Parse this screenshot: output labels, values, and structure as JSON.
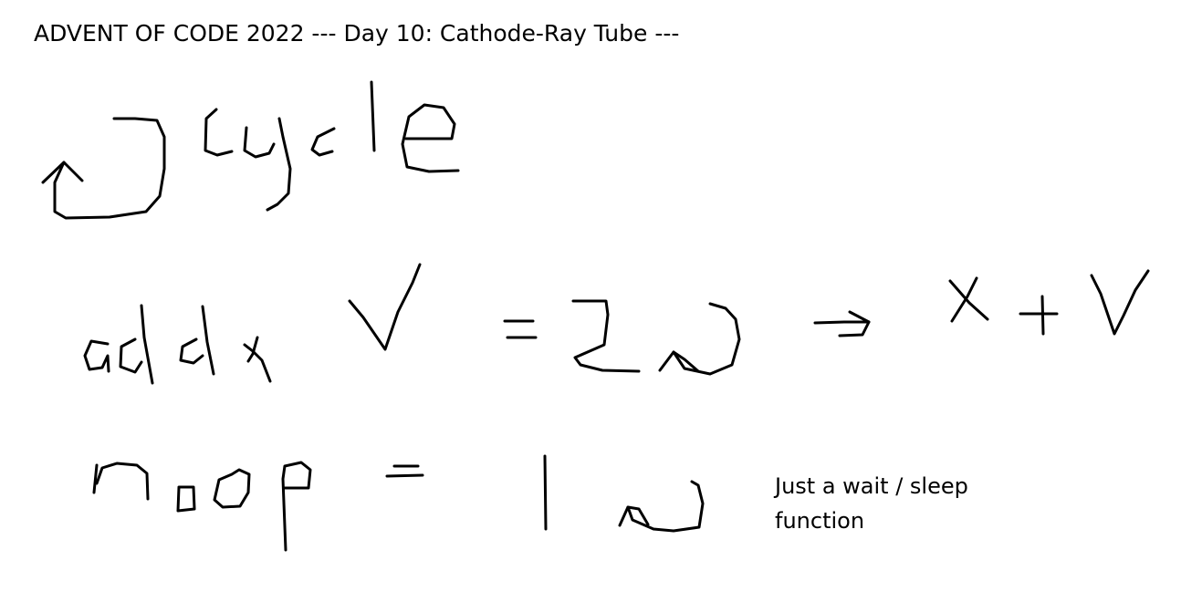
{
  "title": "ADVENT OF CODE 2022 --- Day 10: Cathode-Ray Tube ---",
  "handwritten_text": {
    "cycle_word": "cycle",
    "addx_word": "addx",
    "addx_argument": "V",
    "addx_equals": "=",
    "addx_cycles": "2",
    "addx_result": "x + V",
    "noop_word": "noop",
    "noop_equals": "=",
    "noop_cycles": "1"
  },
  "note": "Just a wait / sleep function",
  "ink_color": "#000000",
  "background_color": "#ffffff"
}
